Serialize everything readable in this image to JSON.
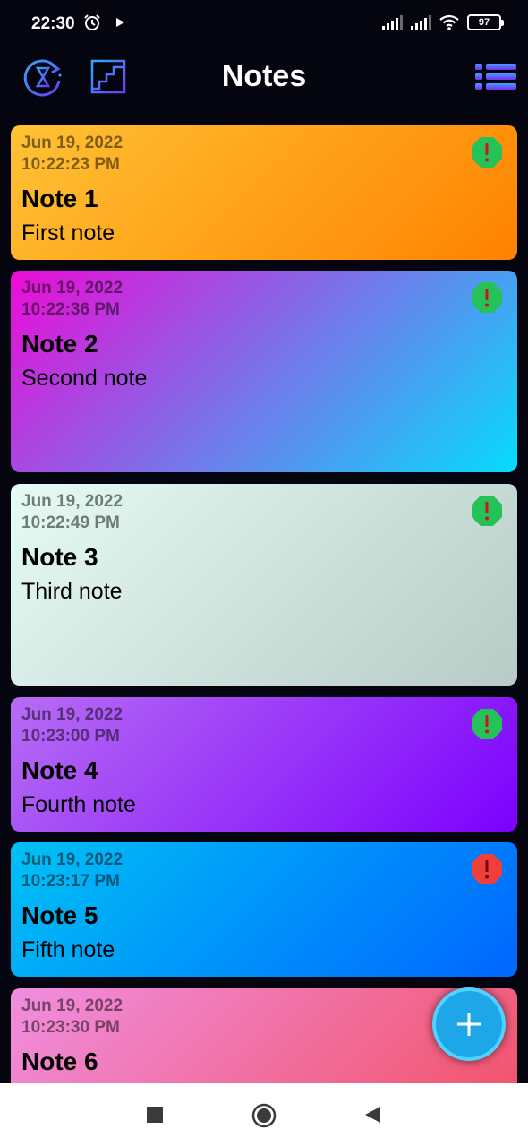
{
  "status_bar": {
    "time": "22:30",
    "battery": "97",
    "icons": [
      "alarm-icon",
      "play-icon",
      "signal-icon",
      "signal-icon",
      "wifi-icon",
      "battery-icon"
    ]
  },
  "app_bar": {
    "title": "Notes",
    "left_icons": [
      "history-icon",
      "stairs-icon"
    ],
    "right_icon": "list-icon"
  },
  "notes": [
    {
      "date": "Jun 19, 2022",
      "time": "10:22:23 PM",
      "title": "Note 1",
      "body": "First note",
      "priority": "normal",
      "colors": [
        "#ffc234",
        "#ff8200"
      ]
    },
    {
      "date": "Jun 19, 2022",
      "time": "10:22:36 PM",
      "title": "Note 2",
      "body": "Second note",
      "priority": "normal",
      "colors": [
        "#ec0bd6",
        "#05dcfc"
      ]
    },
    {
      "date": "Jun 19, 2022",
      "time": "10:22:49 PM",
      "title": "Note 3",
      "body": "Third note",
      "priority": "normal",
      "colors": [
        "#e6fbf5",
        "#b8cbc6"
      ]
    },
    {
      "date": "Jun 19, 2022",
      "time": "10:23:00 PM",
      "title": "Note 4",
      "body": "Fourth note",
      "priority": "normal",
      "colors": [
        "#b66df3",
        "#7c00fe"
      ]
    },
    {
      "date": "Jun 19, 2022",
      "time": "10:23:17 PM",
      "title": "Note 5",
      "body": "Fifth note",
      "priority": "high",
      "colors": [
        "#00c1f5",
        "#0066ff"
      ]
    },
    {
      "date": "Jun 19, 2022",
      "time": "10:23:30 PM",
      "title": "Note 6",
      "body": "",
      "priority": "normal",
      "colors": [
        "#f08ee0",
        "#f25265"
      ]
    }
  ],
  "priority_colors": {
    "normal": "#25c25a",
    "high": "#f03e3a"
  },
  "fab": {
    "icon": "plus-icon"
  },
  "nav_bar": {
    "icons": [
      "recents-square-icon",
      "home-circle-icon",
      "back-triangle-icon"
    ]
  }
}
